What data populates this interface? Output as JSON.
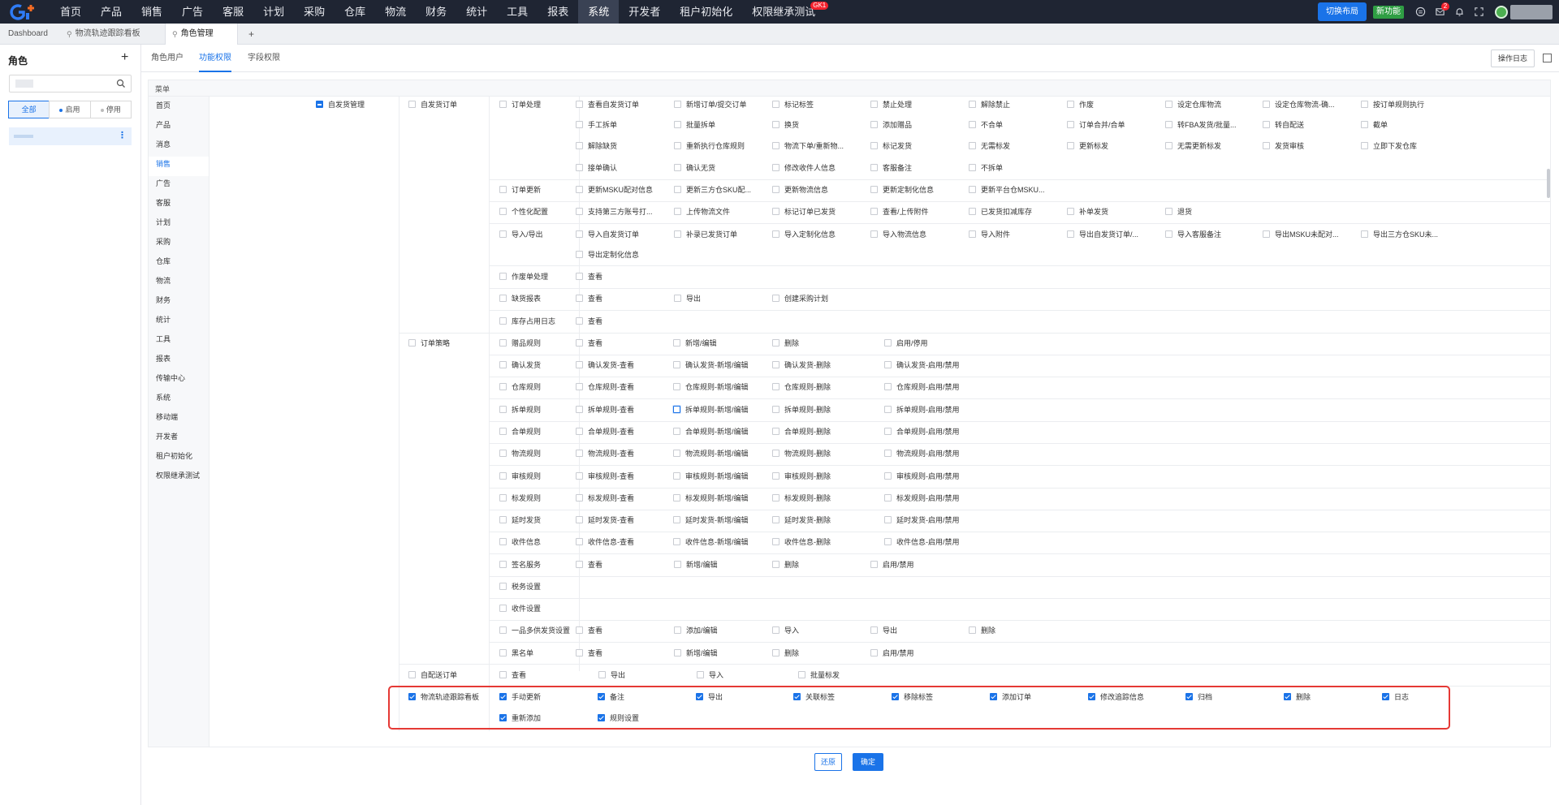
{
  "top_nav": {
    "items": [
      "首页",
      "产品",
      "销售",
      "广告",
      "客服",
      "计划",
      "采购",
      "仓库",
      "物流",
      "财务",
      "统计",
      "工具",
      "报表",
      "系统",
      "开发者",
      "租户初始化",
      "权限继承测试"
    ],
    "active_index": 13,
    "badge": {
      "index": 16,
      "text": "GK1"
    },
    "switch_layout": "切换布局",
    "new_feature": "新功能",
    "message_badge": "2"
  },
  "page_tabs": {
    "dashboard": "Dashboard",
    "tab1": "物流轨迹跟踪看板",
    "tab2": "角色管理",
    "add": "+"
  },
  "sidebar": {
    "title": "角色",
    "add": "+",
    "filters": [
      "全部",
      "启用",
      "停用"
    ],
    "filter_dot_colors": {
      "enabled": "#1a73e8",
      "disabled": "#bbbbbb"
    }
  },
  "sub_tabs": [
    "角色用户",
    "功能权限",
    "字段权限"
  ],
  "sub_tab_active": 1,
  "op_log": "操作日志",
  "menu_header": "菜单",
  "categories": [
    "首页",
    "产品",
    "消息",
    "销售",
    "广告",
    "客服",
    "计划",
    "采购",
    "仓库",
    "物流",
    "财务",
    "统计",
    "工具",
    "报表",
    "传输中心",
    "系统",
    "移动端",
    "开发者",
    "租户初始化",
    "权限继承测试"
  ],
  "category_active": 3,
  "perm": {
    "level1": "自发货管理",
    "groups": [
      {
        "label": "自发货订单",
        "state": "off"
      },
      {
        "label": "订单策略",
        "state": "off"
      },
      {
        "label": "自配送订单",
        "state": "off"
      },
      {
        "label": "物流轨迹跟踪看板",
        "state": "on"
      }
    ],
    "rows": [
      {
        "label": "订单处理",
        "items": [
          "查看自发货订单",
          "新增订单/提交订单",
          "标记标签",
          "禁止处理",
          "解除禁止",
          "作废",
          "设定仓库物流",
          "设定仓库物流-确...",
          "按订单规则执行",
          "手工拆单",
          "批量拆单",
          "换货",
          "添加赠品",
          "不合单",
          "订单合并/合单",
          "转FBA发货/批量...",
          "转自配送",
          "截单",
          "解除缺货",
          "重新执行仓库规则",
          "物流下单/重新物...",
          "标记发货",
          "无需标发",
          "更新标发",
          "无需更新标发",
          "发货审核",
          "立即下发仓库",
          "接单确认",
          "确认无货",
          "修改收件人信息",
          "客服备注",
          "不拆单"
        ]
      },
      {
        "label": "订单更新",
        "items": [
          "更新MSKU配对信息",
          "更新三方仓SKU配...",
          "更新物流信息",
          "更新定制化信息",
          "更新平台仓MSKU..."
        ]
      },
      {
        "label": "个性化配置",
        "items": [
          "支持第三方账号打...",
          "上传物流文件",
          "标记订单已发货",
          "查看/上传附件",
          "已发货扣减库存",
          "补单发货",
          "退货"
        ]
      },
      {
        "label": "导入/导出",
        "items": [
          "导入自发货订单",
          "补录已发货订单",
          "导入定制化信息",
          "导入物流信息",
          "导入附件",
          "导出自发货订单/...",
          "导入客服备注",
          "导出MSKU未配对...",
          "导出三方仓SKU未...",
          "导出定制化信息"
        ]
      },
      {
        "label": "作废单处理",
        "items": [
          "查看"
        ]
      },
      {
        "label": "缺货报表",
        "items": [
          "查看",
          "导出",
          "创建采购计划"
        ]
      },
      {
        "label": "库存占用日志",
        "items": [
          "查看"
        ]
      },
      {
        "label": "赠品规则",
        "items": [
          "查看",
          "新增/编辑",
          "删除",
          "启用/停用"
        ]
      },
      {
        "label": "确认发货",
        "items": [
          "确认发货-查看",
          "确认发货-新增/编辑",
          "确认发货-删除",
          "确认发货-启用/禁用"
        ]
      },
      {
        "label": "仓库规则",
        "items": [
          "仓库规则-查看",
          "仓库规则-新增/编辑",
          "仓库规则-删除",
          "仓库规则-启用/禁用"
        ]
      },
      {
        "label": "拆单规则",
        "items": [
          "拆单规则-查看",
          "拆单规则-新增/编辑",
          "拆单规则-删除",
          "拆单规则-启用/禁用"
        ]
      },
      {
        "label": "合单规则",
        "items": [
          "合单规则-查看",
          "合单规则-新增/编辑",
          "合单规则-删除",
          "合单规则-启用/禁用"
        ]
      },
      {
        "label": "物流规则",
        "items": [
          "物流规则-查看",
          "物流规则-新增/编辑",
          "物流规则-删除",
          "物流规则-启用/禁用"
        ]
      },
      {
        "label": "审核规则",
        "items": [
          "审核规则-查看",
          "审核规则-新增/编辑",
          "审核规则-删除",
          "审核规则-启用/禁用"
        ]
      },
      {
        "label": "标发规则",
        "items": [
          "标发规则-查看",
          "标发规则-新增/编辑",
          "标发规则-删除",
          "标发规则-启用/禁用"
        ]
      },
      {
        "label": "延时发货",
        "items": [
          "延时发货-查看",
          "延时发货-新增/编辑",
          "延时发货-删除",
          "延时发货-启用/禁用"
        ]
      },
      {
        "label": "收件信息",
        "items": [
          "收件信息-查看",
          "收件信息-新增/编辑",
          "收件信息-删除",
          "收件信息-启用/禁用"
        ]
      },
      {
        "label": "签名服务",
        "items": [
          "查看",
          "新增/编辑",
          "删除",
          "启用/禁用"
        ]
      },
      {
        "label": "税务设置",
        "items": []
      },
      {
        "label": "收件设置",
        "items": []
      },
      {
        "label": "一品多供发货设置",
        "items": [
          "查看",
          "添加/编辑",
          "导入",
          "导出",
          "删除"
        ]
      },
      {
        "label": "黑名单",
        "items": [
          "查看",
          "新增/编辑",
          "删除",
          "启用/禁用"
        ]
      }
    ],
    "selfdelivery_items": [
      "查看",
      "导出",
      "导入",
      "批量标发"
    ],
    "tracking_items": [
      "手动更新",
      "备注",
      "导出",
      "关联标签",
      "移除标签",
      "添加订单",
      "修改追踪信息",
      "归档",
      "删除",
      "日志",
      "重新添加",
      "规则设置"
    ]
  },
  "footer": {
    "reset": "还原",
    "ok": "确定"
  }
}
